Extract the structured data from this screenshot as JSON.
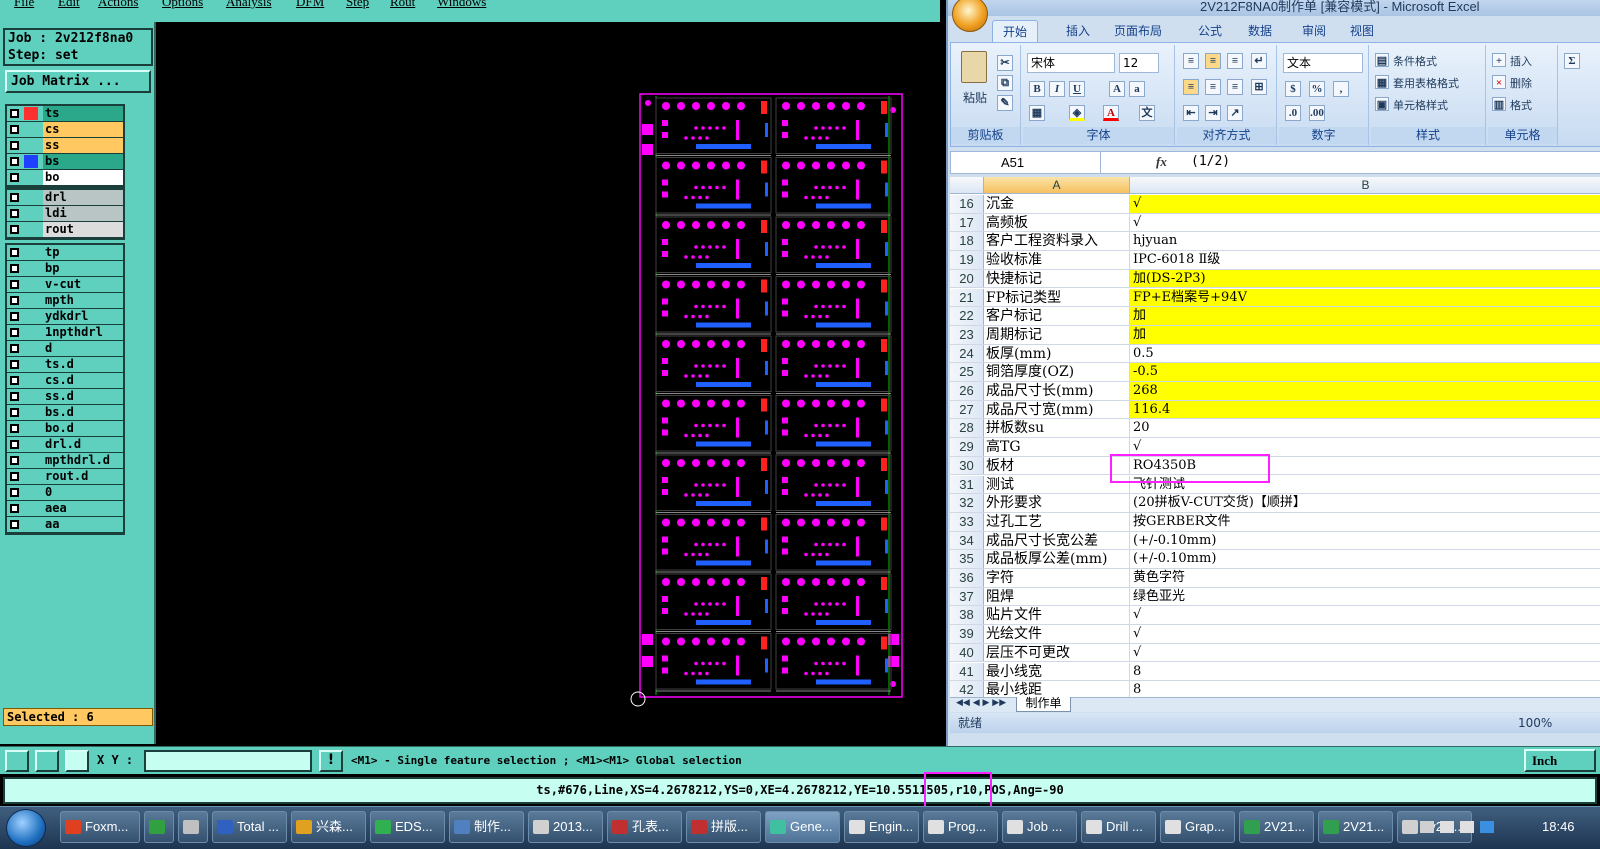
{
  "genesis": {
    "menu": [
      "File",
      "Edit",
      "Actions",
      "Options",
      "Analysis",
      "DFM",
      "Step",
      "Rout",
      "Windows"
    ],
    "job_label": "Job : 2v212f8na0",
    "step_label": "Step: set",
    "job_matrix": "Job Matrix ...",
    "layer_groups": [
      [
        {
          "name": "ts",
          "color": "#2aa889",
          "marker": "red"
        },
        {
          "name": "cs",
          "color": "#ffc860"
        },
        {
          "name": "ss",
          "color": "#ffc860"
        },
        {
          "name": "bs",
          "color": "#2aa889",
          "marker": "blue"
        },
        {
          "name": "bo",
          "color": "#ffffff"
        }
      ],
      [
        {
          "name": "drl",
          "color": "#b9c4c4"
        },
        {
          "name": "ldi",
          "color": "#b9c4c4"
        },
        {
          "name": "rout",
          "color": "#dcdcdc"
        }
      ],
      [
        {
          "name": "tp",
          "color": "#5fcfbe"
        },
        {
          "name": "bp",
          "color": "#5fcfbe"
        },
        {
          "name": "v-cut",
          "color": "#5fcfbe"
        },
        {
          "name": "mpth",
          "color": "#5fcfbe"
        },
        {
          "name": "ydkdrl",
          "color": "#5fcfbe"
        },
        {
          "name": "1npthdrl",
          "color": "#5fcfbe"
        },
        {
          "name": "d",
          "color": "#5fcfbe"
        },
        {
          "name": "ts.d",
          "color": "#5fcfbe"
        },
        {
          "name": "cs.d",
          "color": "#5fcfbe"
        },
        {
          "name": "ss.d",
          "color": "#5fcfbe"
        },
        {
          "name": "bs.d",
          "color": "#5fcfbe"
        },
        {
          "name": "bo.d",
          "color": "#5fcfbe"
        },
        {
          "name": "drl.d",
          "color": "#5fcfbe"
        },
        {
          "name": "mpthdrl.d",
          "color": "#5fcfbe"
        },
        {
          "name": "rout.d",
          "color": "#5fcfbe"
        },
        {
          "name": "0",
          "color": "#5fcfbe"
        },
        {
          "name": "aea",
          "color": "#5fcfbe"
        },
        {
          "name": "aa",
          "color": "#5fcfbe"
        }
      ]
    ],
    "selected": "Selected : 6",
    "xy_label": "X Y :",
    "xy_value": "",
    "hint": "<M1> - Single feature selection ; <M1><M1> Global selection",
    "units": "Inch",
    "status": "ts,#676,Line,XS=4.2678212,YS=0,XE=4.2678212,YE=10.5511505,r10,POS,Ang=-90",
    "panel_rows": 10,
    "panel_cols": 2,
    "colors": {
      "pad": "#ff00ff",
      "trace": "#2060ff",
      "red_mark": "#ff2020",
      "outline": "#00c000"
    }
  },
  "excel": {
    "title": "2V212F8NA0制作单 [兼容模式] - Microsoft Excel",
    "tabs": [
      "开始",
      "插入",
      "页面布局",
      "公式",
      "数据",
      "审阅",
      "视图"
    ],
    "clipboard": {
      "paste": "粘贴",
      "label": "剪贴板"
    },
    "font": {
      "name": "宋体",
      "size": "12",
      "label": "字体"
    },
    "alignment": {
      "label": "对齐方式"
    },
    "number": {
      "format": "文本",
      "label": "数字"
    },
    "styles": {
      "conditional": "条件格式",
      "table": "套用表格格式",
      "cell": "单元格样式",
      "label": "样式"
    },
    "cells": {
      "insert": "插入",
      "delete": "删除",
      "format": "格式",
      "label": "单元格"
    },
    "name_box": "A51",
    "fx": "fx",
    "formula": "(1/2)",
    "columns": [
      "A",
      "B"
    ],
    "rows": [
      {
        "n": "16",
        "a": "沉金",
        "b": "√",
        "yellow": true
      },
      {
        "n": "17",
        "a": "高频板",
        "b": "√",
        "yellow": false
      },
      {
        "n": "18",
        "a": "客户工程资料录入",
        "b": "hjyuan",
        "yellow": false
      },
      {
        "n": "19",
        "a": "验收标准",
        "b": "IPC-6018 Ⅱ级",
        "yellow": false
      },
      {
        "n": "20",
        "a": "快捷标记",
        "b": "加(DS-2P3)",
        "yellow": true
      },
      {
        "n": "21",
        "a": "FP标记类型",
        "b": "FP+E档案号+94V",
        "yellow": true
      },
      {
        "n": "22",
        "a": "客户标记",
        "b": "加",
        "yellow": true
      },
      {
        "n": "23",
        "a": "周期标记",
        "b": "加",
        "yellow": true
      },
      {
        "n": "24",
        "a": "板厚(mm)",
        "b": "0.5",
        "yellow": false
      },
      {
        "n": "25",
        "a": "铜箔厚度(OZ)",
        "b": "-0.5",
        "yellow": true
      },
      {
        "n": "26",
        "a": "成品尺寸长(mm)",
        "b": "268",
        "yellow": true
      },
      {
        "n": "27",
        "a": "成品尺寸宽(mm)",
        "b": "116.4",
        "yellow": true
      },
      {
        "n": "28",
        "a": "拼板数su",
        "b": "20",
        "yellow": false
      },
      {
        "n": "29",
        "a": "高TG",
        "b": "√",
        "yellow": false
      },
      {
        "n": "30",
        "a": "板材",
        "b": "RO4350B",
        "yellow": false
      },
      {
        "n": "31",
        "a": "测试",
        "b": "飞针测试",
        "yellow": false
      },
      {
        "n": "32",
        "a": "外形要求",
        "b": "(20拼板V-CUT交货)【顺拼】",
        "yellow": false
      },
      {
        "n": "33",
        "a": "过孔工艺",
        "b": "按GERBER文件",
        "yellow": false
      },
      {
        "n": "34",
        "a": "成品尺寸长宽公差",
        "b": "(+/-0.10mm)",
        "yellow": false
      },
      {
        "n": "35",
        "a": "成品板厚公差(mm)",
        "b": "(+/-0.10mm)",
        "yellow": false
      },
      {
        "n": "36",
        "a": "字符",
        "b": "黄色字符",
        "yellow": false
      },
      {
        "n": "37",
        "a": "阻焊",
        "b": "绿色亚光",
        "yellow": false
      },
      {
        "n": "38",
        "a": "贴片文件",
        "b": "√",
        "yellow": false
      },
      {
        "n": "39",
        "a": "光绘文件",
        "b": "√",
        "yellow": false
      },
      {
        "n": "40",
        "a": "层压不可更改",
        "b": "√",
        "yellow": false
      },
      {
        "n": "41",
        "a": "最小线宽",
        "b": "8",
        "yellow": false
      },
      {
        "n": "42",
        "a": "最小线距",
        "b": "8",
        "yellow": false
      }
    ],
    "sheet_tab": "制作单",
    "status": "就绪",
    "zoom": "100%"
  },
  "taskbar": {
    "items": [
      {
        "label": "Foxm...",
        "color": "#e04020"
      },
      {
        "label": "",
        "color": "#30a040"
      },
      {
        "label": "",
        "color": "#c0c0c0"
      },
      {
        "label": "Total ...",
        "color": "#3060c0"
      },
      {
        "label": "兴森...",
        "color": "#e0a020"
      },
      {
        "label": "EDS...",
        "color": "#30b050"
      },
      {
        "label": "制作...",
        "color": "#5080c0"
      },
      {
        "label": "2013...",
        "color": "#d0d0d0"
      },
      {
        "label": "孔表...",
        "color": "#c03030"
      },
      {
        "label": "拼版...",
        "color": "#c03030"
      },
      {
        "label": "Gene...",
        "color": "#40c0a0"
      },
      {
        "label": "Engin...",
        "color": "#e0e0e0"
      },
      {
        "label": "Prog...",
        "color": "#e0e0e0"
      },
      {
        "label": "Job ...",
        "color": "#e0e0e0"
      },
      {
        "label": "Drill ...",
        "color": "#e0e0e0"
      },
      {
        "label": "Grap...",
        "color": "#e0e0e0"
      },
      {
        "label": "2V21...",
        "color": "#30a050"
      },
      {
        "label": "2V21...",
        "color": "#30a050"
      },
      {
        "label": "2v21...",
        "color": "#d0d0d0"
      }
    ],
    "clock": "18:46"
  }
}
